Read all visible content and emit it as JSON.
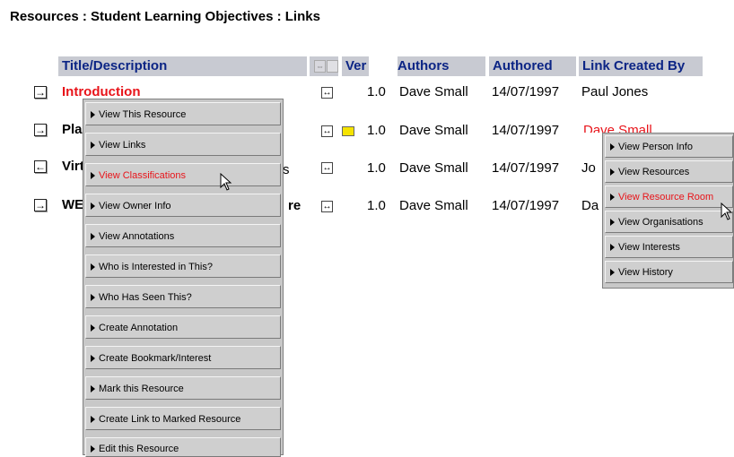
{
  "breadcrumb": "Resources : Student Learning Objectives : Links",
  "table": {
    "headers": {
      "title": "Title/Description",
      "ver": "Ver",
      "authors": "Authors",
      "authored": "Authored",
      "created_by": "Link Created By"
    },
    "rows": [
      {
        "title": "Introduction",
        "title_visible": "Introduction",
        "ver": "1.0",
        "author": "Dave Small",
        "date": "14/07/1997",
        "created_by": "Paul Jones",
        "direction": "forward"
      },
      {
        "title_visible": "Pla",
        "ver": "1.0",
        "author": "Dave Small",
        "date": "14/07/1997",
        "created_by": "Dave Small",
        "direction": "forward",
        "has_note": true
      },
      {
        "title_visible": "Virt",
        "title_tail": "s",
        "ver": "1.0",
        "author": "Dave Small",
        "date": "14/07/1997",
        "created_by_visible": "Jo",
        "direction": "back"
      },
      {
        "title_visible": "WE",
        "title_tail": "re",
        "ver": "1.0",
        "author": "Dave Small",
        "date": "14/07/1997",
        "created_by_visible": "Da",
        "direction": "forward"
      }
    ]
  },
  "resource_menu": {
    "items": [
      "View This Resource",
      "View Links",
      "View Classifications",
      "View Owner Info",
      "View Annotations",
      "Who is Interested in This?",
      "Who Has Seen This?",
      "Create Annotation",
      "Create Bookmark/Interest",
      "Mark this Resource",
      "Create Link to Marked Resource",
      "Edit this Resource"
    ],
    "highlighted_index": 2
  },
  "person_menu": {
    "items": [
      "View Person Info",
      "View Resources",
      "View Resource Room",
      "View Organisations",
      "View Interests",
      "View History"
    ],
    "highlighted_index": 2
  },
  "colors": {
    "header_bg": "#c8cad2",
    "header_text": "#0c2585",
    "link_red": "#e8141a",
    "note_yellow": "#f5e300",
    "menu_bg": "#c8c8c8"
  }
}
